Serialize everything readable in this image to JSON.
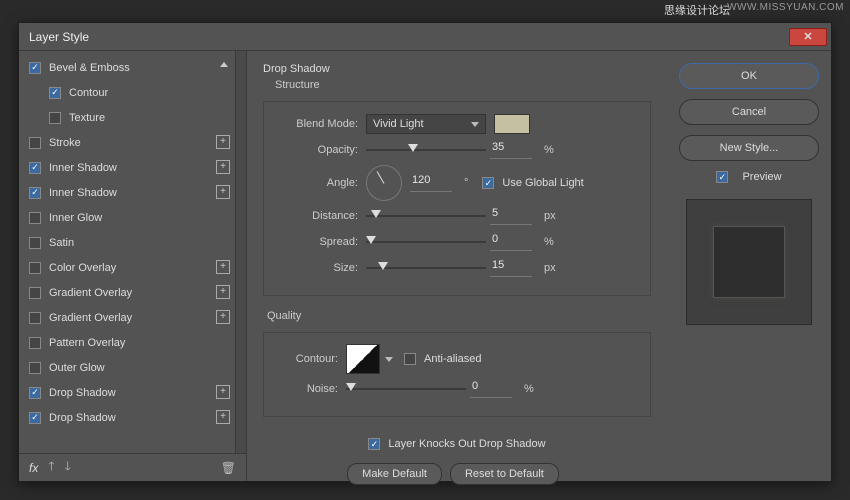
{
  "watermark_cn": "思缘设计论坛",
  "watermark_en": "WWW.MISSYUAN.COM",
  "dialog_title": "Layer Style",
  "styles": [
    {
      "label": "Bevel & Emboss",
      "checked": true,
      "selected": false,
      "plus": false,
      "sub": false,
      "chev": true
    },
    {
      "label": "Contour",
      "checked": true,
      "selected": false,
      "plus": false,
      "sub": true
    },
    {
      "label": "Texture",
      "checked": false,
      "selected": false,
      "plus": false,
      "sub": true
    },
    {
      "label": "Stroke",
      "checked": false,
      "selected": false,
      "plus": true,
      "sub": false
    },
    {
      "label": "Inner Shadow",
      "checked": true,
      "selected": false,
      "plus": true,
      "sub": false
    },
    {
      "label": "Inner Shadow",
      "checked": true,
      "selected": false,
      "plus": true,
      "sub": false
    },
    {
      "label": "Inner Glow",
      "checked": false,
      "selected": false,
      "plus": false,
      "sub": false
    },
    {
      "label": "Satin",
      "checked": false,
      "selected": false,
      "plus": false,
      "sub": false
    },
    {
      "label": "Color Overlay",
      "checked": false,
      "selected": false,
      "plus": true,
      "sub": false
    },
    {
      "label": "Gradient Overlay",
      "checked": false,
      "selected": false,
      "plus": true,
      "sub": false
    },
    {
      "label": "Gradient Overlay",
      "checked": false,
      "selected": false,
      "plus": true,
      "sub": false
    },
    {
      "label": "Pattern Overlay",
      "checked": false,
      "selected": false,
      "plus": false,
      "sub": false
    },
    {
      "label": "Outer Glow",
      "checked": false,
      "selected": false,
      "plus": false,
      "sub": false
    },
    {
      "label": "Drop Shadow",
      "checked": true,
      "selected": false,
      "plus": true,
      "sub": false
    },
    {
      "label": "Drop Shadow",
      "checked": true,
      "selected": true,
      "plus": true,
      "sub": false
    }
  ],
  "panel": {
    "title": "Drop Shadow",
    "section_structure": "Structure",
    "blend_mode_label": "Blend Mode:",
    "blend_mode_value": "Vivid Light",
    "swatch_color": "#c6c0a3",
    "opacity_label": "Opacity:",
    "opacity_value": "35",
    "opacity_unit": "%",
    "angle_label": "Angle:",
    "angle_value": "120",
    "angle_unit": "°",
    "use_global_label": "Use Global Light",
    "use_global_checked": true,
    "distance_label": "Distance:",
    "distance_value": "5",
    "distance_unit": "px",
    "spread_label": "Spread:",
    "spread_value": "0",
    "spread_unit": "%",
    "size_label": "Size:",
    "size_value": "15",
    "size_unit": "px",
    "section_quality": "Quality",
    "contour_label": "Contour:",
    "antialias_label": "Anti-aliased",
    "antialias_checked": false,
    "noise_label": "Noise:",
    "noise_value": "0",
    "noise_unit": "%",
    "knockout_label": "Layer Knocks Out Drop Shadow",
    "knockout_checked": true,
    "make_default": "Make Default",
    "reset_default": "Reset to Default"
  },
  "right": {
    "ok": "OK",
    "cancel": "Cancel",
    "new_style": "New Style...",
    "preview_label": "Preview",
    "preview_checked": true
  },
  "footer": {
    "fx": "fx"
  }
}
